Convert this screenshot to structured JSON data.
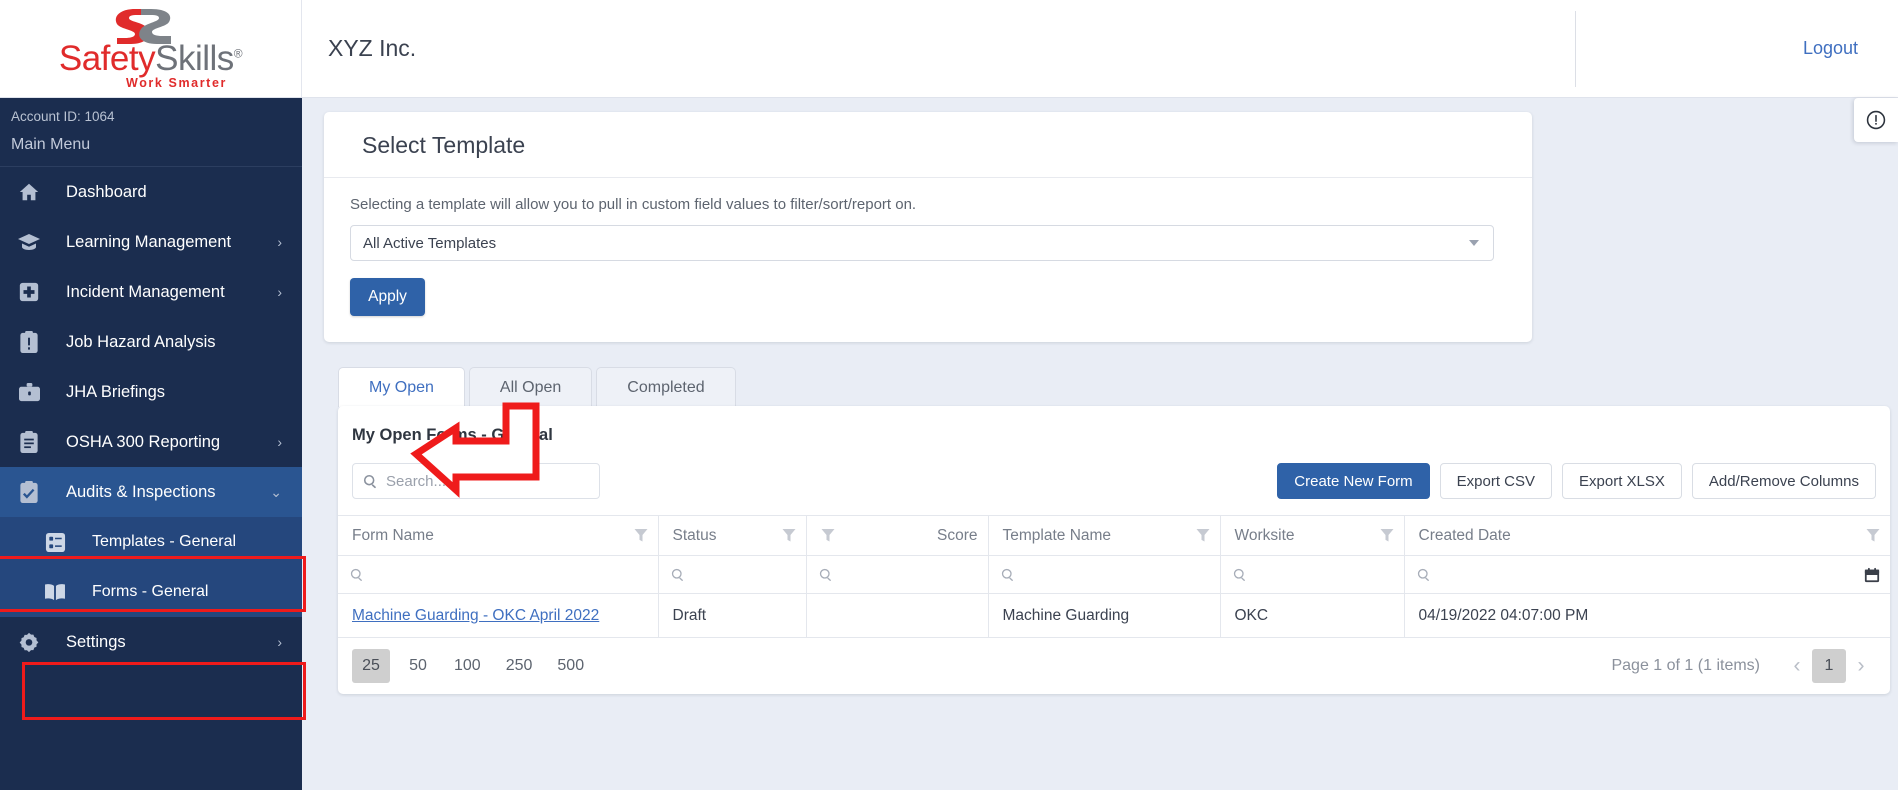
{
  "topbar": {
    "logo_name": "SafetySkills",
    "logo_safety": "Safety",
    "logo_skills": "Skills",
    "logo_reg": "®",
    "logo_tagline": "Work Smarter",
    "company": "XYZ Inc.",
    "logout": "Logout"
  },
  "sidebar": {
    "account_id": "Account ID: 1064",
    "main_menu": "Main Menu",
    "items": [
      {
        "label": "Dashboard",
        "icon": "home-icon",
        "expandable": false,
        "active": false
      },
      {
        "label": "Learning Management",
        "icon": "graduation-cap-icon",
        "expandable": true,
        "active": false
      },
      {
        "label": "Incident Management",
        "icon": "first-aid-icon",
        "expandable": true,
        "active": false
      },
      {
        "label": "Job Hazard Analysis",
        "icon": "clipboard-alert-icon",
        "expandable": false,
        "active": false
      },
      {
        "label": "JHA Briefings",
        "icon": "briefcase-icon",
        "expandable": false,
        "active": false
      },
      {
        "label": "OSHA 300 Reporting",
        "icon": "clipboard-list-icon",
        "expandable": true,
        "active": false
      },
      {
        "label": "Audits & Inspections",
        "icon": "clipboard-check-icon",
        "expandable": true,
        "active": true
      },
      {
        "label": "Templates - General",
        "icon": "template-grid-icon",
        "sub": true,
        "active": false
      },
      {
        "label": "Forms - General",
        "icon": "book-icon",
        "sub": true,
        "active": false
      },
      {
        "label": "Settings",
        "icon": "gear-icon",
        "expandable": true,
        "active": false
      }
    ]
  },
  "template_panel": {
    "title": "Select Template",
    "description": "Selecting a template will allow you to pull in custom field values to filter/sort/report on.",
    "select_value": "All Active Templates",
    "apply_label": "Apply"
  },
  "tabs": [
    {
      "label": "My Open",
      "active": true
    },
    {
      "label": "All Open",
      "active": false
    },
    {
      "label": "Completed",
      "active": false
    }
  ],
  "grid": {
    "title": "My Open Forms - General",
    "search_placeholder": "Search...",
    "search_value": "",
    "buttons": [
      {
        "label": "Create New Form",
        "style": "primary"
      },
      {
        "label": "Export CSV",
        "style": "default"
      },
      {
        "label": "Export XLSX",
        "style": "default"
      },
      {
        "label": "Add/Remove Columns",
        "style": "default"
      }
    ],
    "columns": [
      {
        "label": "Form Name",
        "align": "left",
        "filter": true
      },
      {
        "label": "Status",
        "align": "left",
        "filter": true
      },
      {
        "label": "Score",
        "align": "right",
        "filter": true
      },
      {
        "label": "Template Name",
        "align": "left",
        "filter": true
      },
      {
        "label": "Worksite",
        "align": "left",
        "filter": true
      },
      {
        "label": "Created Date",
        "align": "left",
        "filter": true
      }
    ],
    "rows": [
      {
        "form_name": "Machine Guarding - OKC April 2022",
        "status": "Draft",
        "score": "",
        "template_name": "Machine Guarding",
        "worksite": "OKC",
        "created_date": "04/19/2022 04:07:00 PM"
      }
    ],
    "page_sizes": [
      "25",
      "50",
      "100",
      "250",
      "500"
    ],
    "page_size_selected": "25",
    "page_info": "Page 1 of 1 (1 items)",
    "current_page": "1"
  },
  "colors": {
    "sidebar_bg": "#1b2d4f",
    "sidebar_active": "#2a5591",
    "sidebar_sub": "#25477d",
    "primary_blue": "#2f62a8",
    "link_blue": "#3f6fc0",
    "annotation_red": "#ef1b1b",
    "logo_red": "#e02b2b",
    "page_bg": "#e9edf5"
  }
}
